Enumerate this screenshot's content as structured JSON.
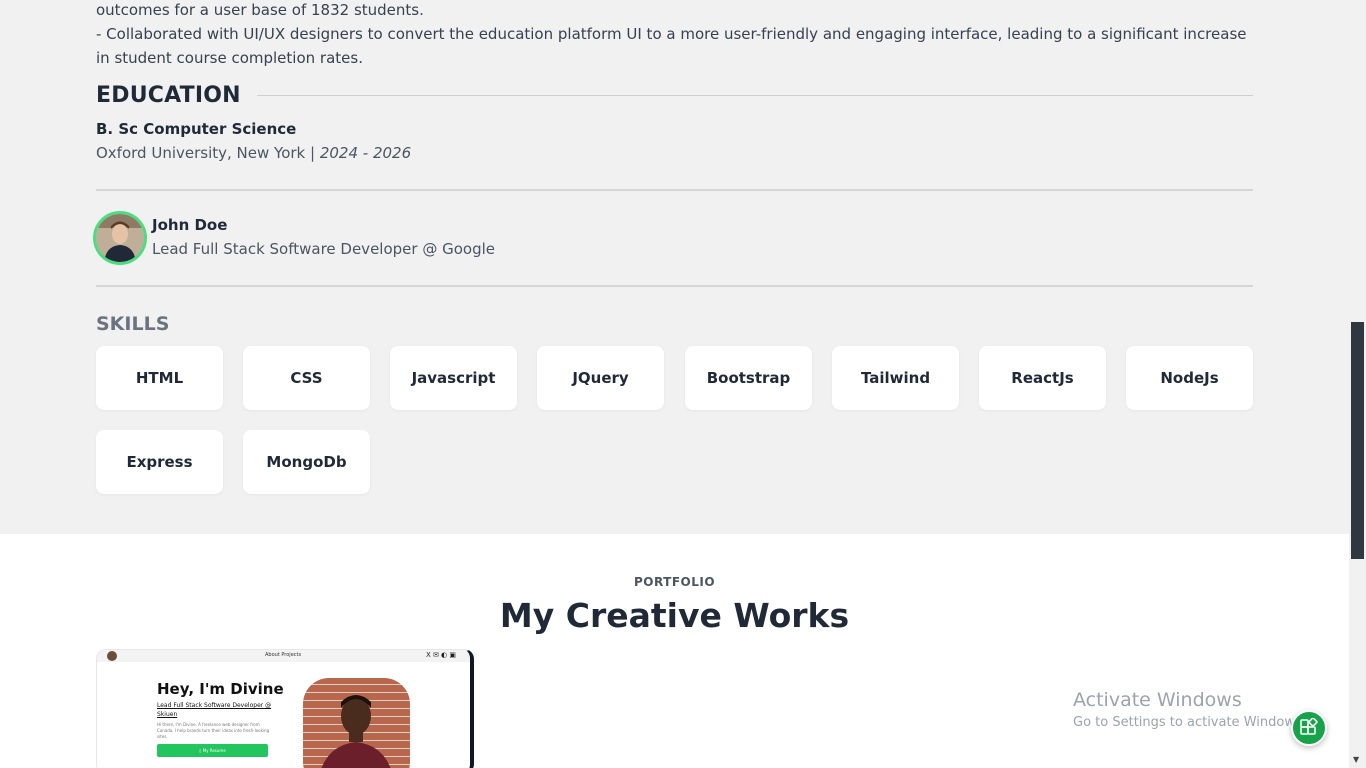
{
  "experience": {
    "line1": "outcomes for a user base of 1832 students.",
    "line2": "- Collaborated with UI/UX designers to convert the education platform UI to a more user-friendly and engaging interface, leading to a significant increase in student course completion rates."
  },
  "education": {
    "heading": "EDUCATION",
    "degree": "B. Sc Computer Science",
    "school": "Oxford University, New York | ",
    "years": "2024 - 2026"
  },
  "profile": {
    "name": "John Doe",
    "title": "Lead Full Stack Software Developer @ Google"
  },
  "skills": {
    "heading": "SKILLS",
    "items": [
      "HTML",
      "CSS",
      "Javascript",
      "JQuery",
      "Bootstrap",
      "Tailwind",
      "ReactJs",
      "NodeJs",
      "Express",
      "MongoDb"
    ]
  },
  "portfolio": {
    "label": "PORTFOLIO",
    "title": "My Creative Works",
    "project_preview": {
      "nav_links": "About   Projects",
      "nav_icons": "X ✉ ◐ ▣",
      "heading": "Hey, I'm Divine",
      "subheading": "Lead Full Stack Software Developer @ Skiuen",
      "body": "Hi there, I'm Divine. A freelance web designer from Canada. I help brands turn their ideas into fresh-looking sites.",
      "button": "▯ My Resume"
    }
  },
  "watermark": {
    "title": "Activate Windows",
    "subtitle": "Go to Settings to activate Windows."
  },
  "colors": {
    "accent": "#16a34a",
    "section_bg": "#f1f1f1",
    "avatar_ring": "#4ade80"
  }
}
